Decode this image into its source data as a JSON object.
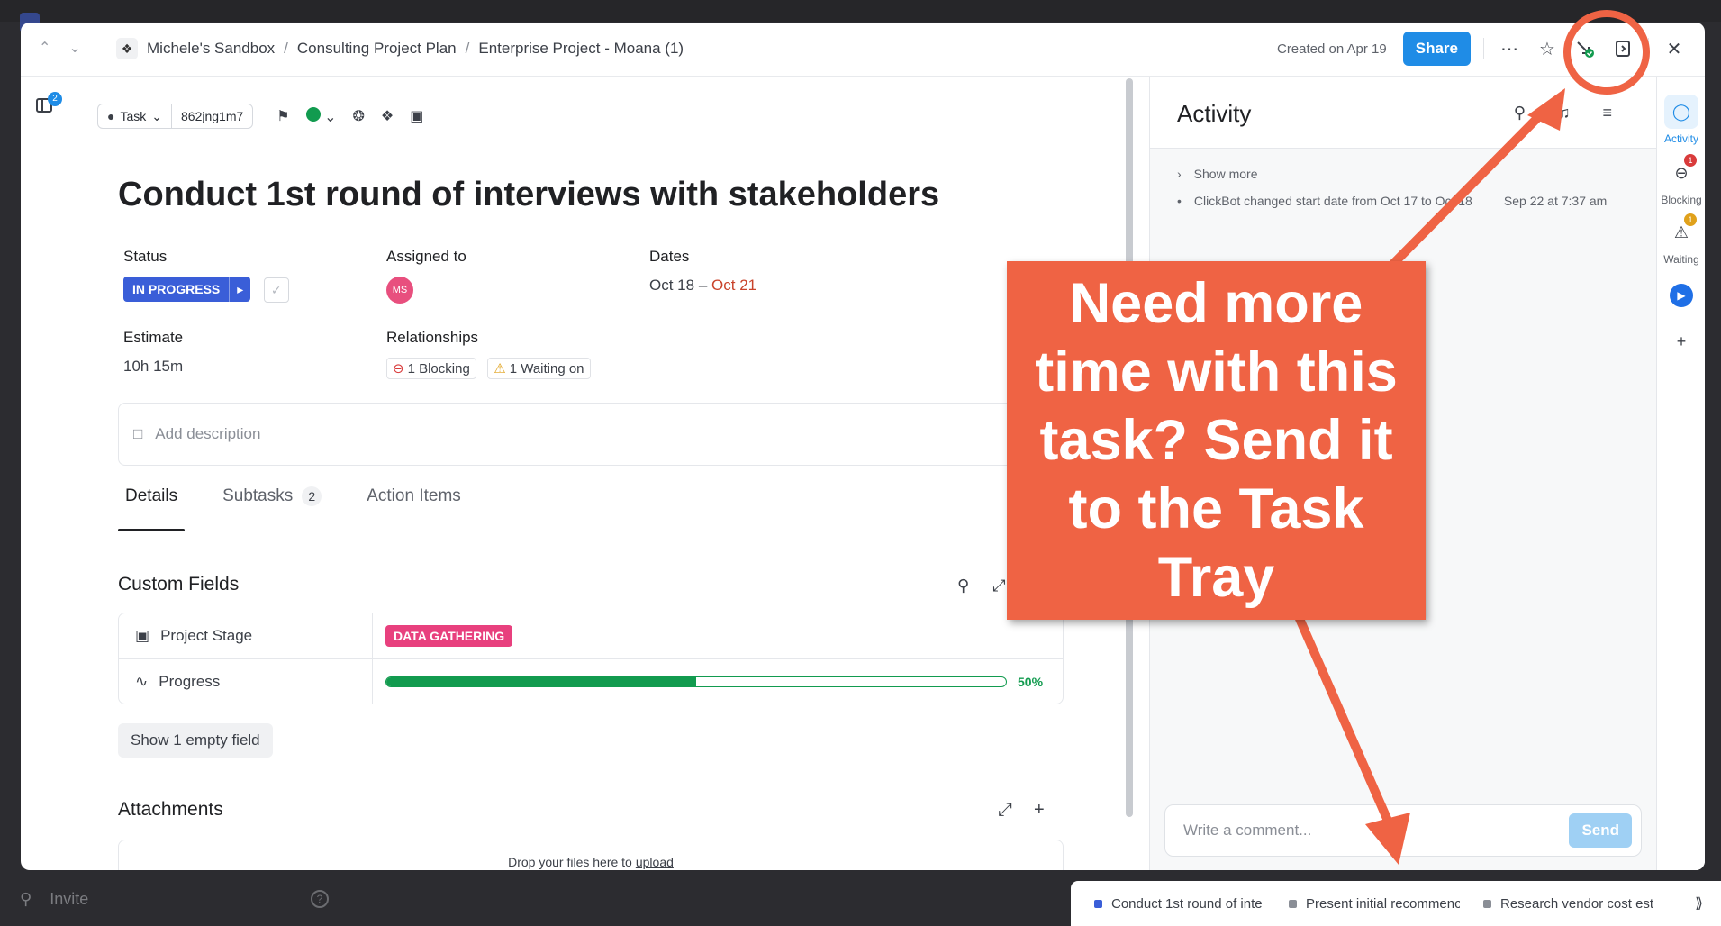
{
  "header": {
    "breadcrumb": [
      "Michele's Sandbox",
      "Consulting Project Plan",
      "Enterprise Project - Moana (1)"
    ],
    "created": "Created on Apr 19",
    "share_label": "Share",
    "more_icon": "⋯",
    "close_icon": "✕"
  },
  "left_rail": {
    "badge": "2"
  },
  "task": {
    "type_label": "Task",
    "id": "862jng1m7",
    "title": "Conduct 1st round of interviews with stakeholders",
    "fields": {
      "status_label": "Status",
      "status_value": "IN PROGRESS",
      "assigned_label": "Assigned to",
      "assignee_initials": "MS",
      "dates_label": "Dates",
      "start_date": "Oct 18",
      "date_sep": "–",
      "due_date": "Oct 21",
      "estimate_label": "Estimate",
      "estimate_value": "10h 15m",
      "relationships_label": "Relationships",
      "blocking": "1 Blocking",
      "waiting": "1 Waiting on"
    },
    "description_placeholder": "Add description"
  },
  "tabs": [
    {
      "label": "Details"
    },
    {
      "label": "Subtasks",
      "count": "2"
    },
    {
      "label": "Action Items"
    }
  ],
  "custom_fields": {
    "title": "Custom Fields",
    "rows": [
      {
        "name": "Project Stage",
        "value": "DATA GATHERING",
        "color": "#e8407e"
      },
      {
        "name": "Progress",
        "percent_label": "50%",
        "percent": 0.5,
        "color": "#129b4f"
      }
    ],
    "show_empty": "Show 1 empty field"
  },
  "attachments": {
    "title": "Attachments",
    "drop_text": "Drop your files here to",
    "upload_link": "upload"
  },
  "activity": {
    "title": "Activity",
    "show_more": "Show more",
    "log": [
      {
        "text": "ClickBot changed start date from Oct 17 to Oct 18",
        "time": "Sep 22 at 7:37 am"
      }
    ],
    "comment_placeholder": "Write a comment...",
    "send_label": "Send"
  },
  "right_sidebar": [
    {
      "label": "Activity",
      "icon": "chat-icon"
    },
    {
      "label": "Blocking",
      "icon": "minus-circle-icon",
      "badge": "1",
      "badge_color": "#d93b3b"
    },
    {
      "label": "Waiting",
      "icon": "warning-icon",
      "badge": "1",
      "badge_color": "#e0a11b"
    }
  ],
  "tray": {
    "items": [
      {
        "label": "Conduct 1st round of inte",
        "color": "#3a5ed8"
      },
      {
        "label": "Present initial recommenc",
        "color": "#8a8e96"
      },
      {
        "label": "Research vendor cost esti",
        "color": "#8a8e96"
      }
    ]
  },
  "sidebar_bg": {
    "invite": "Invite"
  },
  "annotation": {
    "callout_text": "Need more time with this task? Send it to the Task Tray",
    "color": "#ef6344"
  }
}
